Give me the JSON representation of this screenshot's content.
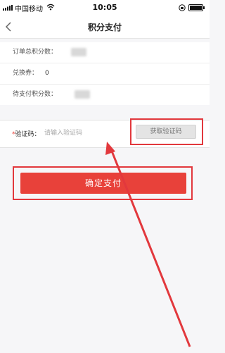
{
  "status_bar": {
    "carrier": "中国移动",
    "time": "10:05"
  },
  "nav": {
    "title": "积分支付",
    "back_icon": "chevron-left-icon"
  },
  "info_rows": [
    {
      "label": "订单总积分数：",
      "value": "",
      "value_redacted": true
    },
    {
      "label": "兑换券：",
      "value": "0",
      "value_redacted": false
    },
    {
      "label": "待支付积分数：",
      "value": "",
      "value_redacted": true
    }
  ],
  "verification": {
    "required_mark": "*",
    "label": "验证码：",
    "placeholder": "请输入验证码",
    "value": "",
    "get_code_label": "获取验证码"
  },
  "confirm_button_label": "确定支付",
  "colors": {
    "accent": "#e8413a",
    "highlight": "#e2383d",
    "page_bg": "#f6f6f8"
  }
}
